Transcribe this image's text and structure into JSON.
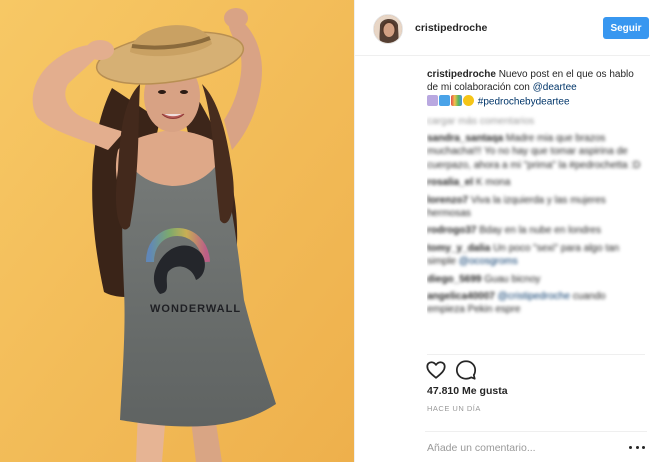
{
  "post": {
    "username": "cristipedroche",
    "follow_label": "Seguir",
    "caption": {
      "username": "cristipedroche",
      "text": " Nuevo post en el que os hablo de mi colaboración con ",
      "mention": "@deartee",
      "hashtag": "#pedrochebydeartee"
    },
    "load_more": "cargar más comentarios",
    "comments": [
      {
        "user": "sandra_santaqa",
        "text": " Madre mia que brazos muchacha!!! Yo no hay que tomar aspirina de cuerpazo, ahora a mi \"prima\" la #pedrochetta :D"
      },
      {
        "user": "rosalia_el",
        "text": " K mona"
      },
      {
        "user": "lorenzo7",
        "text": " Viva la izquierda y las mujeres hermosas"
      },
      {
        "user": "rodrogo37",
        "text": " Bday en la nube en londres"
      },
      {
        "user": "tomy_y_dalia",
        "text": " Un poco \"sexi\" para algo tan simple ",
        "mention": "@ocosgroms"
      },
      {
        "user": "diego_5699",
        "text": " Guau bicnoy"
      },
      {
        "user": "angelica40007",
        "text": " ",
        "mention": "@cristipedroche",
        "text2": " cuando empieza Pekin espre"
      }
    ],
    "likes": "47.810 Me gusta",
    "time": "HACE UN DÍA",
    "comment_placeholder": "Añade un comentario...",
    "icons": [
      "heart-icon",
      "comment-icon",
      "more-icon"
    ],
    "colors": {
      "accent": "#3897f0",
      "photo_background": "#f3bd58",
      "dress": "#6f7371"
    }
  }
}
